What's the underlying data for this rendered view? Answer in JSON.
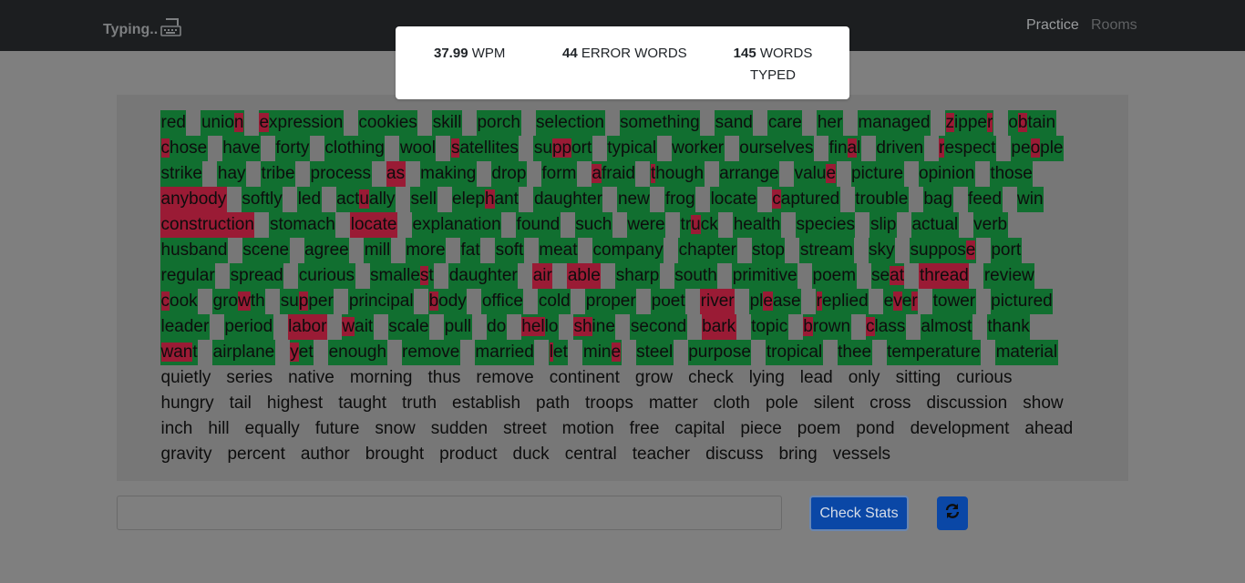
{
  "navbar": {
    "brand": "Typing..",
    "brand_icon": "keyboard-icon",
    "links": [
      {
        "label": "Practice"
      },
      {
        "label": "Rooms"
      }
    ]
  },
  "stats": {
    "wpm_value": "37.99",
    "wpm_label": "WPM",
    "errors_value": "44",
    "errors_label": "ERROR WORDS",
    "words_value": "145",
    "words_label": "WORDS TYPED"
  },
  "colors": {
    "correct": "#116f30",
    "error": "#9a1b35",
    "accent": "#0a47a6"
  },
  "words_typed": [
    "red",
    "union",
    "expression",
    "cookies",
    "skill",
    "porch",
    "selection",
    "something",
    "sand",
    "care",
    "her",
    "managed",
    "zipper",
    "obtain",
    "chose",
    "have",
    "forty",
    "clothing",
    "wool",
    "satellites",
    "support",
    "typical",
    "worker",
    "ourselves",
    "final",
    "driven",
    "respect",
    "people",
    "strike",
    "hay",
    "tribe",
    "process",
    "as",
    "making",
    "drop",
    "form",
    "afraid",
    "though",
    "arrange",
    "value",
    "picture",
    "opinion",
    "those",
    "anybody",
    "softly",
    "led",
    "actually",
    "sell",
    "elephant",
    "daughter",
    "new",
    "frog",
    "locate",
    "captured",
    "trouble",
    "bag",
    "feed",
    "win",
    "construction",
    "stomach",
    "locate",
    "explanation",
    "found",
    "such",
    "were",
    "truck",
    "health",
    "species",
    "slip",
    "actual",
    "verb",
    "husband",
    "scene",
    "agree",
    "mill",
    "more",
    "fat",
    "soft",
    "meat",
    "company",
    "chapter",
    "stop",
    "stream",
    "sky",
    "suppose",
    "port",
    "regular",
    "spread",
    "curious",
    "smallest",
    "daughter",
    "air",
    "able",
    "sharp",
    "south",
    "primitive",
    "poem",
    "seat",
    "thread",
    "review",
    "cook",
    "growth",
    "supper",
    "principal",
    "body",
    "office",
    "cold",
    "proper",
    "poet",
    "river",
    "please",
    "replied",
    "ever",
    "tower",
    "pictured",
    "leader",
    "period",
    "labor",
    "wait",
    "scale",
    "pull",
    "do",
    "hello",
    "shine",
    "second",
    "bark",
    "topic",
    "brown",
    "class",
    "almost",
    "thank",
    "want",
    "airplane",
    "yet",
    "enough",
    "remove",
    "married",
    "let",
    "mine",
    "steel",
    "purpose",
    "tropical",
    "thee",
    "temperature",
    "material"
  ],
  "words_remaining": [
    "quietly",
    "series",
    "native",
    "morning",
    "thus",
    "remove",
    "continent",
    "grow",
    "check",
    "lying",
    "lead",
    "only",
    "sitting",
    "curious",
    "hungry",
    "tail",
    "highest",
    "taught",
    "truth",
    "establish",
    "path",
    "troops",
    "matter",
    "cloth",
    "pole",
    "silent",
    "cross",
    "discussion",
    "show",
    "inch",
    "hill",
    "equally",
    "future",
    "snow",
    "sudden",
    "street",
    "motion",
    "free",
    "capital",
    "piece",
    "poem",
    "pond",
    "development",
    "ahead",
    "gravity",
    "percent",
    "author",
    "brought",
    "product",
    "duck",
    "central",
    "teacher",
    "discuss",
    "bring",
    "vessels"
  ],
  "input": {
    "value": "",
    "placeholder": ""
  },
  "buttons": {
    "check_stats": "Check Stats",
    "refresh_icon": "refresh-icon"
  }
}
